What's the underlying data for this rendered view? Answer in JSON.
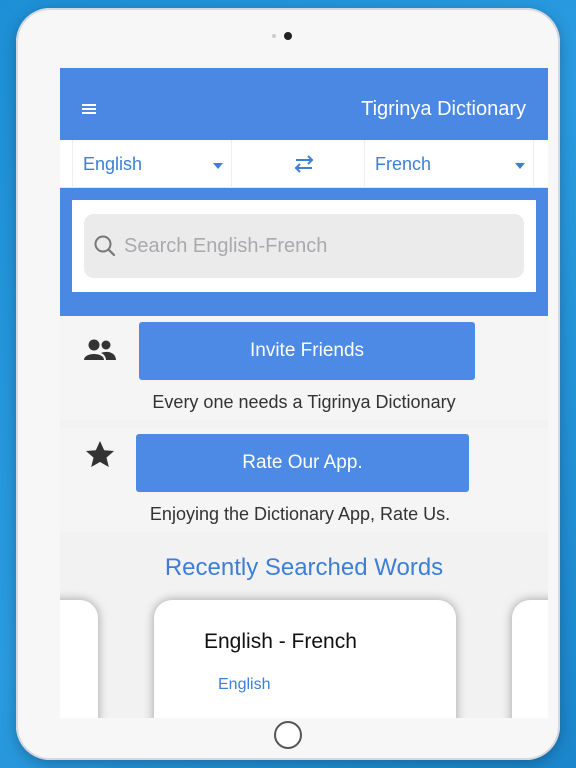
{
  "nav": {
    "title": "Tigrinya Dictionary",
    "menu_icon": "hamburger-menu-icon"
  },
  "languages": {
    "source": "English",
    "target": "French",
    "swap_icon": "swap-arrows-icon"
  },
  "search": {
    "placeholder": "Search English-French",
    "icon": "search-icon"
  },
  "invite": {
    "button_label": "Invite Friends",
    "caption": "Every one needs a Tigrinya Dictionary",
    "icon": "users-icon"
  },
  "rate": {
    "button_label": "Rate Our App.",
    "caption": "Enjoying the Dictionary App, Rate Us.",
    "icon": "star-icon"
  },
  "recent": {
    "title": "Recently Searched Words",
    "card": {
      "title": "English - French",
      "subtitle": "English"
    }
  },
  "colors": {
    "accent": "#4a88e4",
    "link": "#3d7fd6",
    "background": "#2a9be0"
  }
}
